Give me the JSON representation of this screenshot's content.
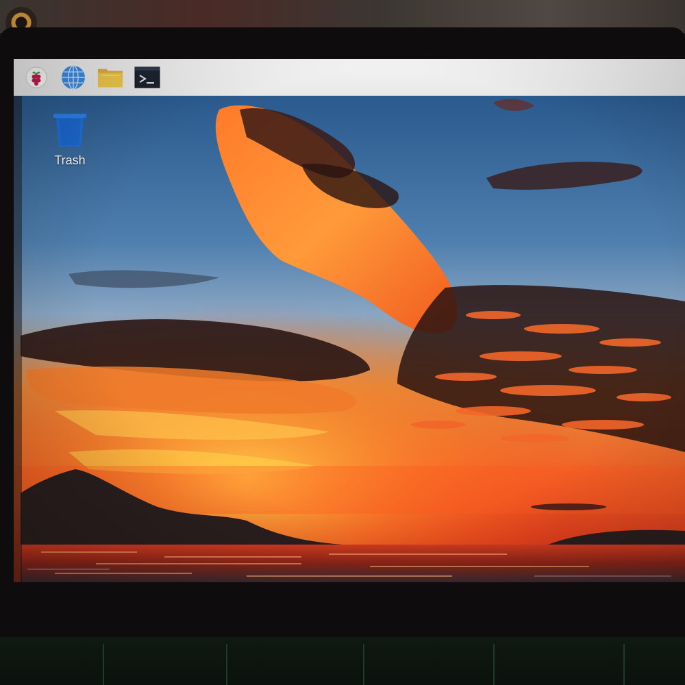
{
  "taskbar": {
    "menu_icon": "raspberry-pi-icon",
    "browser_icon": "globe-icon",
    "files_icon": "folder-icon",
    "terminal_icon": "terminal-icon"
  },
  "desktop": {
    "icons": [
      {
        "label": "Trash",
        "icon": "trash-bin-icon"
      }
    ]
  },
  "colors": {
    "taskbar_bg": "#eeeeee",
    "trash_blue": "#1e6fd9",
    "globe_blue": "#3d8ee6",
    "folder_yellow": "#f2c94c",
    "terminal_bg": "#1c2430"
  }
}
